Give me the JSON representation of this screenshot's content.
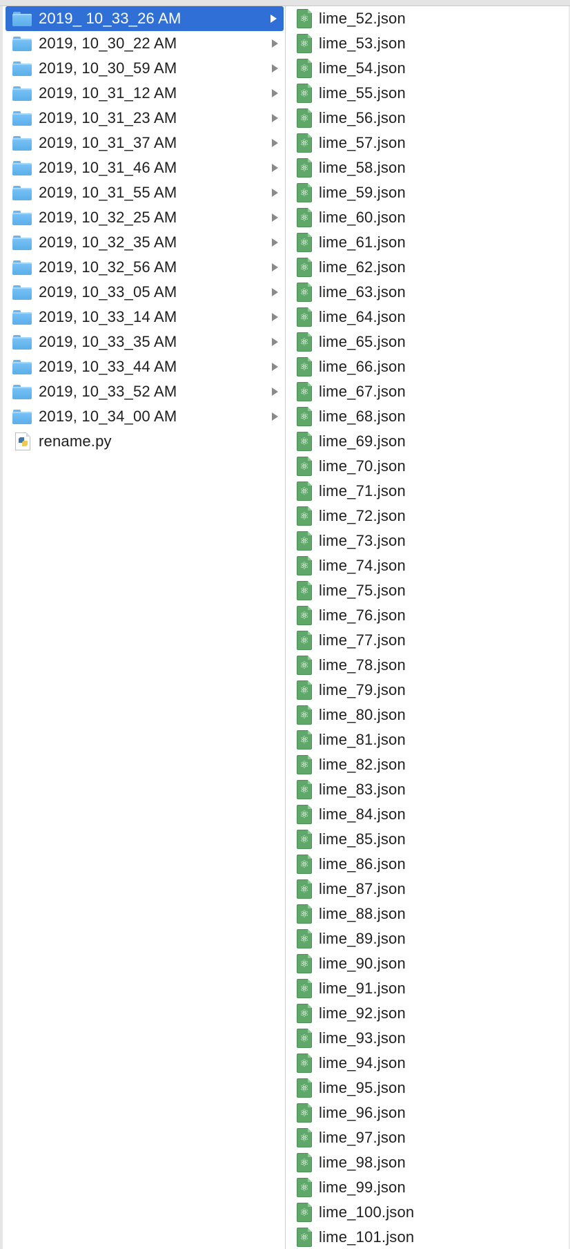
{
  "left_column": {
    "items": [
      {
        "name": "2019_ 10_33_26 AM",
        "type": "folder",
        "selected": true
      },
      {
        "name": "2019, 10_30_22 AM",
        "type": "folder",
        "selected": false
      },
      {
        "name": "2019, 10_30_59 AM",
        "type": "folder",
        "selected": false
      },
      {
        "name": "2019, 10_31_12 AM",
        "type": "folder",
        "selected": false
      },
      {
        "name": "2019, 10_31_23 AM",
        "type": "folder",
        "selected": false
      },
      {
        "name": "2019, 10_31_37 AM",
        "type": "folder",
        "selected": false
      },
      {
        "name": "2019, 10_31_46 AM",
        "type": "folder",
        "selected": false
      },
      {
        "name": "2019, 10_31_55 AM",
        "type": "folder",
        "selected": false
      },
      {
        "name": "2019, 10_32_25 AM",
        "type": "folder",
        "selected": false
      },
      {
        "name": "2019, 10_32_35 AM",
        "type": "folder",
        "selected": false
      },
      {
        "name": "2019, 10_32_56 AM",
        "type": "folder",
        "selected": false
      },
      {
        "name": "2019, 10_33_05 AM",
        "type": "folder",
        "selected": false
      },
      {
        "name": "2019, 10_33_14 AM",
        "type": "folder",
        "selected": false
      },
      {
        "name": "2019, 10_33_35 AM",
        "type": "folder",
        "selected": false
      },
      {
        "name": "2019, 10_33_44 AM",
        "type": "folder",
        "selected": false
      },
      {
        "name": "2019, 10_33_52 AM",
        "type": "folder",
        "selected": false
      },
      {
        "name": "2019, 10_34_00 AM",
        "type": "folder",
        "selected": false
      },
      {
        "name": "rename.py",
        "type": "python-file",
        "selected": false
      }
    ]
  },
  "right_column": {
    "icon": "atom-json-file-icon",
    "items": [
      "lime_52.json",
      "lime_53.json",
      "lime_54.json",
      "lime_55.json",
      "lime_56.json",
      "lime_57.json",
      "lime_58.json",
      "lime_59.json",
      "lime_60.json",
      "lime_61.json",
      "lime_62.json",
      "lime_63.json",
      "lime_64.json",
      "lime_65.json",
      "lime_66.json",
      "lime_67.json",
      "lime_68.json",
      "lime_69.json",
      "lime_70.json",
      "lime_71.json",
      "lime_72.json",
      "lime_73.json",
      "lime_74.json",
      "lime_75.json",
      "lime_76.json",
      "lime_77.json",
      "lime_78.json",
      "lime_79.json",
      "lime_80.json",
      "lime_81.json",
      "lime_82.json",
      "lime_83.json",
      "lime_84.json",
      "lime_85.json",
      "lime_86.json",
      "lime_87.json",
      "lime_88.json",
      "lime_89.json",
      "lime_90.json",
      "lime_91.json",
      "lime_92.json",
      "lime_93.json",
      "lime_94.json",
      "lime_95.json",
      "lime_96.json",
      "lime_97.json",
      "lime_98.json",
      "lime_99.json",
      "lime_100.json",
      "lime_101.json"
    ]
  },
  "colors": {
    "selection": "#2f6fd6",
    "folder": "#6bb5ef",
    "json_icon": "#5fa86a",
    "chevron": "#8a8a8a"
  }
}
